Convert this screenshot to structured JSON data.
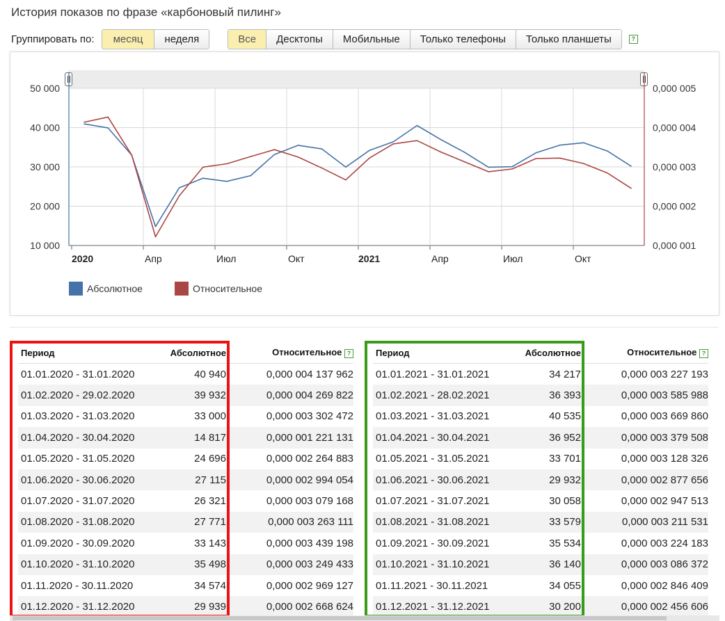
{
  "title": "История показов по фразе «карбоновый пилинг»",
  "group": {
    "label": "Группировать по:",
    "options": [
      "месяц",
      "неделя"
    ],
    "active": 0
  },
  "devices": {
    "options": [
      "Все",
      "Десктопы",
      "Мобильные",
      "Только телефоны",
      "Только планшеты"
    ],
    "active": 0
  },
  "help_glyph": "?",
  "chart_data": {
    "type": "line",
    "x": [
      "01.2020",
      "02.2020",
      "03.2020",
      "04.2020",
      "05.2020",
      "06.2020",
      "07.2020",
      "08.2020",
      "09.2020",
      "10.2020",
      "11.2020",
      "12.2020",
      "01.2021",
      "02.2021",
      "03.2021",
      "04.2021",
      "05.2021",
      "06.2021",
      "07.2021",
      "08.2021",
      "09.2021",
      "10.2021",
      "11.2021",
      "12.2021"
    ],
    "x_ticks": [
      "2020",
      "Апр",
      "Июл",
      "Окт",
      "2021",
      "Апр",
      "Июл",
      "Окт"
    ],
    "y_left": {
      "ticks": [
        "50 000",
        "40 000",
        "30 000",
        "20 000",
        "10 000"
      ],
      "ylim": [
        10000,
        50000
      ]
    },
    "y_right": {
      "ticks": [
        "0,000 005",
        "0,000 004",
        "0,000 003",
        "0,000 002",
        "0,000 001"
      ],
      "ylim": [
        1e-06,
        5e-06
      ]
    },
    "series": [
      {
        "name": "Абсолютное",
        "color": "#4572a7",
        "axis": "left",
        "values": [
          40940,
          39932,
          33000,
          14817,
          24696,
          27115,
          26321,
          27771,
          33143,
          35498,
          34574,
          29939,
          34217,
          36393,
          40535,
          36952,
          33701,
          29932,
          30058,
          33579,
          35534,
          36140,
          34055,
          30200
        ]
      },
      {
        "name": "Относительное",
        "color": "#aa4643",
        "axis": "right",
        "values": [
          4.137962e-06,
          4.269822e-06,
          3.302472e-06,
          1.221131e-06,
          2.264883e-06,
          2.994054e-06,
          3.079168e-06,
          3.263111e-06,
          3.439198e-06,
          3.249433e-06,
          2.969127e-06,
          2.668624e-06,
          3.227193e-06,
          3.585988e-06,
          3.66986e-06,
          3.379508e-06,
          3.128326e-06,
          2.877656e-06,
          2.947513e-06,
          3.211531e-06,
          3.224183e-06,
          3.086372e-06,
          2.846409e-06,
          2.456606e-06
        ]
      }
    ]
  },
  "table": {
    "headers": {
      "period": "Период",
      "absolute": "Абсолютное",
      "relative": "Относительное"
    },
    "left": [
      [
        "01.01.2020 - 31.01.2020",
        "40 940",
        "0,000 004 137 962"
      ],
      [
        "01.02.2020 - 29.02.2020",
        "39 932",
        "0,000 004 269 822"
      ],
      [
        "01.03.2020 - 31.03.2020",
        "33 000",
        "0,000 003 302 472"
      ],
      [
        "01.04.2020 - 30.04.2020",
        "14 817",
        "0,000 001 221 131"
      ],
      [
        "01.05.2020 - 31.05.2020",
        "24 696",
        "0,000 002 264 883"
      ],
      [
        "01.06.2020 - 30.06.2020",
        "27 115",
        "0,000 002 994 054"
      ],
      [
        "01.07.2020 - 31.07.2020",
        "26 321",
        "0,000 003 079 168"
      ],
      [
        "01.08.2020 - 31.08.2020",
        "27 771",
        "0,000 003 263 111"
      ],
      [
        "01.09.2020 - 30.09.2020",
        "33 143",
        "0,000 003 439 198"
      ],
      [
        "01.10.2020 - 31.10.2020",
        "35 498",
        "0,000 003 249 433"
      ],
      [
        "01.11.2020 - 30.11.2020",
        "34 574",
        "0,000 002 969 127"
      ],
      [
        "01.12.2020 - 31.12.2020",
        "29 939",
        "0,000 002 668 624"
      ]
    ],
    "right": [
      [
        "01.01.2021 - 31.01.2021",
        "34 217",
        "0,000 003 227 193"
      ],
      [
        "01.02.2021 - 28.02.2021",
        "36 393",
        "0,000 003 585 988"
      ],
      [
        "01.03.2021 - 31.03.2021",
        "40 535",
        "0,000 003 669 860"
      ],
      [
        "01.04.2021 - 30.04.2021",
        "36 952",
        "0,000 003 379 508"
      ],
      [
        "01.05.2021 - 31.05.2021",
        "33 701",
        "0,000 003 128 326"
      ],
      [
        "01.06.2021 - 30.06.2021",
        "29 932",
        "0,000 002 877 656"
      ],
      [
        "01.07.2021 - 31.07.2021",
        "30 058",
        "0,000 002 947 513"
      ],
      [
        "01.08.2021 - 31.08.2021",
        "33 579",
        "0,000 003 211 531"
      ],
      [
        "01.09.2021 - 30.09.2021",
        "35 534",
        "0,000 003 224 183"
      ],
      [
        "01.10.2021 - 31.10.2021",
        "36 140",
        "0,000 003 086 372"
      ],
      [
        "01.11.2021 - 30.11.2021",
        "34 055",
        "0,000 002 846 409"
      ],
      [
        "01.12.2021 - 31.12.2021",
        "30 200",
        "0,000 002 456 606"
      ]
    ]
  },
  "highlight_colors": {
    "left": "#ee1111",
    "right": "#3a9a1a"
  }
}
